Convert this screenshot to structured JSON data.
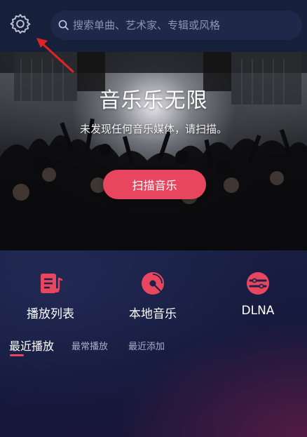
{
  "header": {
    "settings_icon": "gear-icon",
    "search": {
      "icon": "search-icon",
      "placeholder": "搜索单曲、艺术家、专辑或风格"
    }
  },
  "hero": {
    "title": "音乐乐无限",
    "subtitle": "未发现任何音乐媒体，请扫描。",
    "scan_button": "扫描音乐"
  },
  "quick_access": [
    {
      "label": "播放列表",
      "icon": "playlist-icon"
    },
    {
      "label": "本地音乐",
      "icon": "disc-icon"
    },
    {
      "label": "DLNA",
      "icon": "dlna-icon"
    }
  ],
  "tabs": [
    {
      "label": "最近播放",
      "active": true
    },
    {
      "label": "最常播放",
      "active": false
    },
    {
      "label": "最近添加",
      "active": false
    }
  ],
  "colors": {
    "accent": "#e8455f",
    "header_bg": "#17203b",
    "panel_bg": "#15193c",
    "annotation_arrow": "#e02424"
  }
}
